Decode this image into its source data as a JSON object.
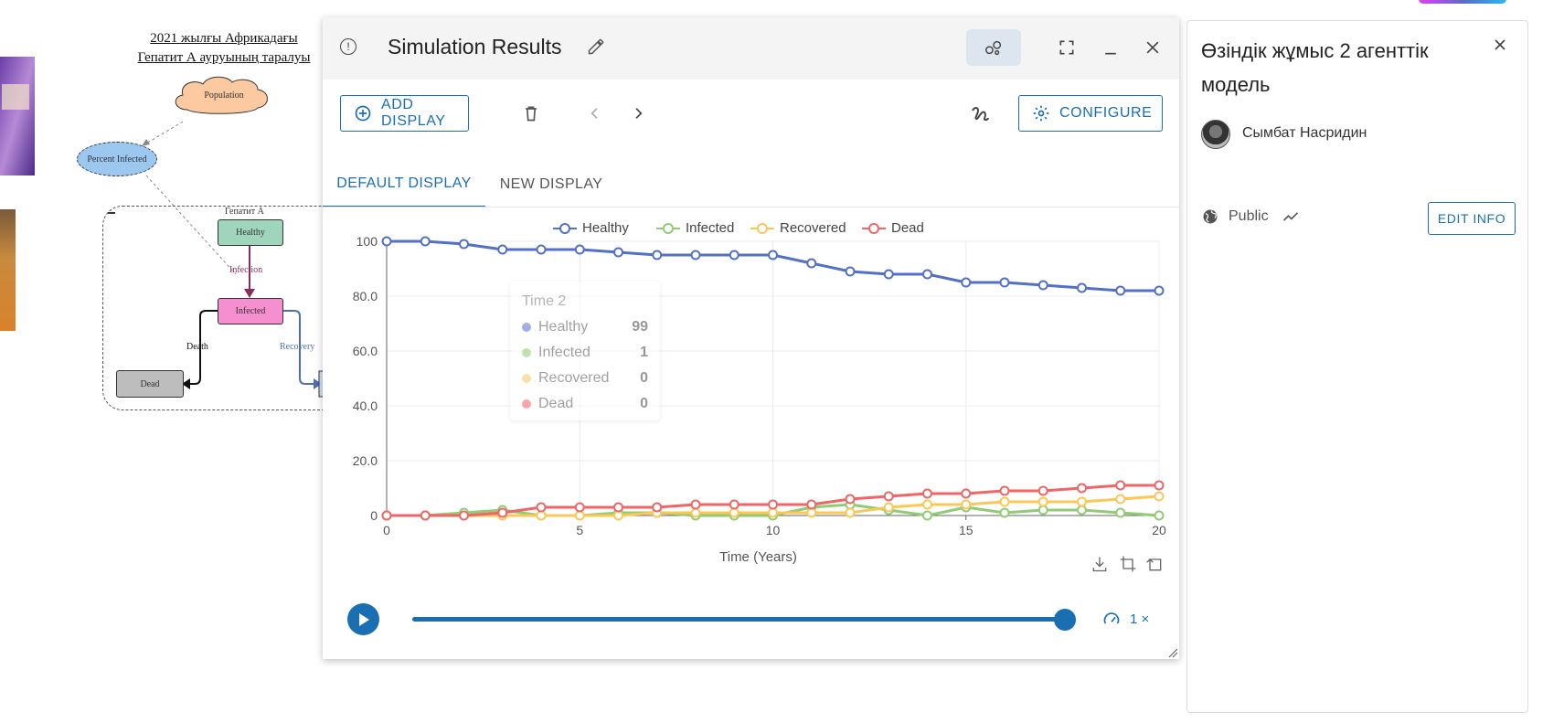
{
  "diagram": {
    "title_line1": "2021 жылғы Африкадағы",
    "title_line2": "Гепатит А ауруының таралуы",
    "population": "Population",
    "percent_infected": "Percent Infected",
    "group_label": "Гепатит А",
    "healthy": "Healthy",
    "infected": "Infected",
    "dead": "Dead",
    "flow_infection": "Infection",
    "flow_death": "Death",
    "flow_recovery": "Recovery",
    "colors": {
      "healthy": "#9fd6bb",
      "infected": "#f58fcf",
      "dead": "#bdbdbd",
      "population": "#fcc9a0",
      "percent_infected": "#9cc8f0"
    }
  },
  "sim": {
    "title": "Simulation Results",
    "add_display": "ADD DISPLAY",
    "configure": "CONFIGURE",
    "tabs": [
      {
        "label": "DEFAULT DISPLAY",
        "active": true
      },
      {
        "label": "NEW DISPLAY",
        "active": false
      }
    ],
    "tooltip": {
      "title": "Time 2",
      "rows": [
        {
          "name": "Healthy",
          "value": "99"
        },
        {
          "name": "Infected",
          "value": "1"
        },
        {
          "name": "Recovered",
          "value": "0"
        },
        {
          "name": "Dead",
          "value": "0"
        }
      ]
    },
    "playback_progress": 1.0,
    "speed": "1 ×",
    "accent": "#1a6fb3"
  },
  "chart_data": {
    "type": "line",
    "x": [
      0,
      1,
      2,
      3,
      4,
      5,
      6,
      7,
      8,
      9,
      10,
      11,
      12,
      13,
      14,
      15,
      16,
      17,
      18,
      19,
      20
    ],
    "series": [
      {
        "name": "Healthy",
        "color": "#5470c6",
        "values": [
          100,
          100,
          99,
          97,
          97,
          97,
          96,
          95,
          95,
          95,
          95,
          92,
          89,
          88,
          88,
          85,
          85,
          84,
          83,
          82,
          82
        ]
      },
      {
        "name": "Infected",
        "color": "#91cc75",
        "values": [
          0,
          0,
          1,
          2,
          0,
          0,
          1,
          1,
          0,
          0,
          0,
          3,
          4,
          2,
          0,
          3,
          1,
          2,
          2,
          1,
          0
        ]
      },
      {
        "name": "Recovered",
        "color": "#fac858",
        "values": [
          0,
          0,
          0,
          0,
          0,
          0,
          0,
          1,
          1,
          1,
          1,
          1,
          1,
          3,
          4,
          4,
          5,
          5,
          5,
          6,
          7
        ]
      },
      {
        "name": "Dead",
        "color": "#ee6666",
        "values": [
          0,
          0,
          0,
          1,
          3,
          3,
          3,
          3,
          4,
          4,
          4,
          4,
          6,
          7,
          8,
          8,
          9,
          9,
          10,
          11,
          11
        ]
      }
    ],
    "xlabel": "Time (Years)",
    "ylabel": "",
    "xlim": [
      0,
      20
    ],
    "ylim": [
      0,
      100
    ],
    "x_ticks": [
      "0",
      "5",
      "10",
      "15",
      "20"
    ],
    "y_ticks": [
      "0",
      "20.0",
      "40.0",
      "60.0",
      "80.0",
      "100"
    ],
    "grid": true,
    "legend": "top-center"
  },
  "info_panel": {
    "title": "Өзіндік жұмыс 2 агенттік модель",
    "author": "Сымбат Насридин",
    "visibility": "Public",
    "edit_info": "EDIT INFO"
  }
}
